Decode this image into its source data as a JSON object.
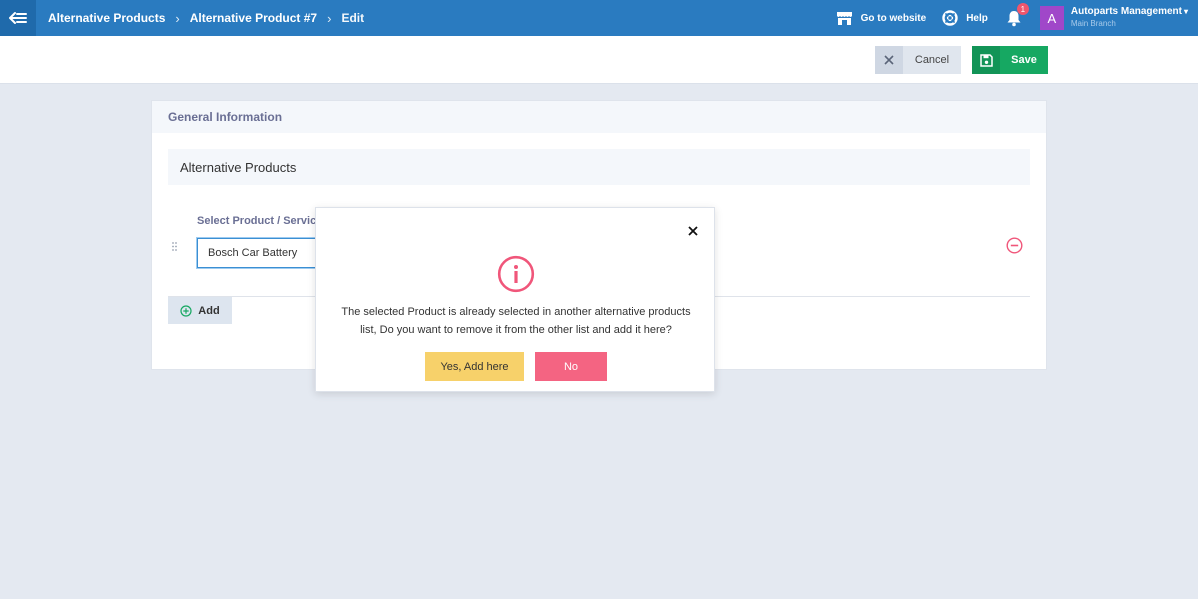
{
  "topbar": {
    "breadcrumbs": [
      "Alternative Products",
      "Alternative Product #7",
      "Edit"
    ],
    "go_to_website": "Go to website",
    "help": "Help",
    "notification_count": "1",
    "avatar_letter": "A",
    "account_name": "Autoparts Management",
    "account_branch": "Main Branch"
  },
  "actions": {
    "cancel": "Cancel",
    "save": "Save"
  },
  "card": {
    "header": "General Information",
    "section_title": "Alternative Products",
    "field_label": "Select Product / Service",
    "product_value": "Bosch Car Battery",
    "add_label": "Add"
  },
  "modal": {
    "message": "The selected Product is already selected in another alternative products list, Do you want to remove it from the other list and add it here?",
    "yes_label": "Yes, Add here",
    "no_label": "No"
  },
  "colors": {
    "topbar": "#2a7bc0",
    "save": "#16a862",
    "warning_icon": "#f0567a",
    "yes_button": "#f7d16a",
    "no_button": "#f46482"
  },
  "icons": [
    "back-arrow-icon",
    "chevron-right-icon",
    "store-icon",
    "lifebuoy-icon",
    "bell-icon",
    "caret-down-icon",
    "close-icon",
    "floppy-disk-icon",
    "drag-handle-icon",
    "minus-circle-icon",
    "plus-circle-icon",
    "info-circle-icon"
  ]
}
